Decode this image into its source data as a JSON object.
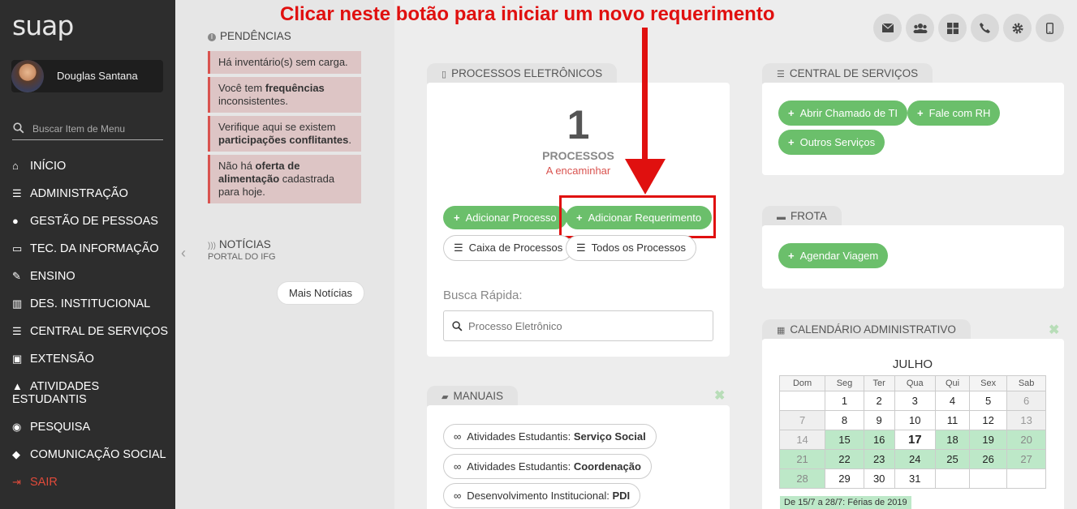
{
  "sidebar": {
    "logo": "suap",
    "user_name": "Douglas Santana",
    "search_placeholder": "Buscar Item de Menu",
    "menu": [
      {
        "label": "INÍCIO",
        "icon": "home-icon"
      },
      {
        "label": "ADMINISTRAÇÃO",
        "icon": "administration-icon"
      },
      {
        "label": "GESTÃO DE PESSOAS",
        "icon": "users-icon"
      },
      {
        "label": "TEC. DA INFORMAÇÃO",
        "icon": "laptop-icon"
      },
      {
        "label": "ENSINO",
        "icon": "pencil-icon"
      },
      {
        "label": "DES. INSTITUCIONAL",
        "icon": "bar-chart-icon"
      },
      {
        "label": "CENTRAL DE SERVIÇOS",
        "icon": "list-icon"
      },
      {
        "label": "EXTENSÃO",
        "icon": "briefcase-icon"
      },
      {
        "label": "ATIVIDADES ESTUDANTIS",
        "icon": "graduation-cap-icon"
      },
      {
        "label": "PESQUISA",
        "icon": "globe-icon"
      },
      {
        "label": "COMUNICAÇÃO SOCIAL",
        "icon": "comment-icon"
      },
      {
        "label": "SAIR",
        "icon": "sign-out-icon"
      }
    ]
  },
  "pendencias": {
    "title": "PENDÊNCIAS",
    "items": [
      {
        "pre": "Há inventário(s) sem carga.",
        "bold": "",
        "post": ""
      },
      {
        "pre": "Você tem ",
        "bold": "frequências",
        "post": " inconsistentes."
      },
      {
        "pre": "Verifique aqui se existem ",
        "bold": "participações conflitantes",
        "post": "."
      },
      {
        "pre": "Não há ",
        "bold": "oferta de alimentação",
        "post": " cadastrada para hoje."
      }
    ]
  },
  "noticias": {
    "title": "NOTÍCIAS",
    "subtitle": "PORTAL DO IFG",
    "more_button": "Mais Notícias"
  },
  "annotation": "Clicar neste botão para iniciar um novo requerimento",
  "processos": {
    "tab": "PROCESSOS ELETRÔNICOS",
    "count": "1",
    "count_label": "PROCESSOS",
    "status": "A encaminhar",
    "add_process": "Adicionar Processo",
    "add_request": "Adicionar Requerimento",
    "inbox": "Caixa de Processos",
    "all": "Todos os Processos",
    "quick_search_label": "Busca Rápida:",
    "quick_search_placeholder": "Processo Eletrônico"
  },
  "manuais": {
    "tab": "MANUAIS",
    "items": [
      {
        "pre": "Atividades Estudantis: ",
        "bold": "Serviço Social"
      },
      {
        "pre": "Atividades Estudantis: ",
        "bold": "Coordenação"
      },
      {
        "pre": "Desenvolvimento Institucional: ",
        "bold": "PDI"
      }
    ]
  },
  "central": {
    "tab": "CENTRAL DE SERVIÇOS",
    "buttons": [
      "Abrir Chamado de TI",
      "Fale com RH",
      "Outros Serviços"
    ]
  },
  "frota": {
    "tab": "FROTA",
    "button": "Agendar Viagem"
  },
  "calendario": {
    "tab": "CALENDÁRIO ADMINISTRATIVO",
    "month": "JULHO",
    "weekdays": [
      "Dom",
      "Seg",
      "Ter",
      "Qua",
      "Qui",
      "Sex",
      "Sab"
    ],
    "weeks": [
      [
        "",
        "1",
        "2",
        "3",
        "4",
        "5",
        "6"
      ],
      [
        "7",
        "8",
        "9",
        "10",
        "11",
        "12",
        "13"
      ],
      [
        "14",
        "15",
        "16",
        "17",
        "18",
        "19",
        "20"
      ],
      [
        "21",
        "22",
        "23",
        "24",
        "25",
        "26",
        "27"
      ],
      [
        "28",
        "29",
        "30",
        "31",
        "",
        "",
        ""
      ]
    ],
    "today": "17",
    "legend": "De 15/7 a 28/7: Férias de 2019"
  },
  "colors": {
    "accent_green": "#6bbf6b",
    "danger_red": "#d9534f",
    "annotation_red": "#e0100f",
    "sidebar_bg": "#2d2d2d"
  }
}
